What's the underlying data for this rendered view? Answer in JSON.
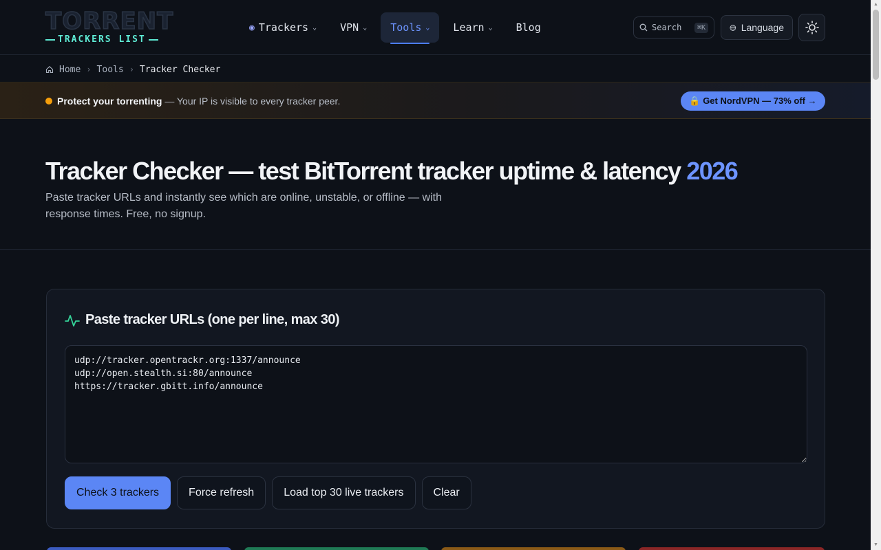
{
  "logo": {
    "top": "TORRENT",
    "bottom": "TRACKERS LIST"
  },
  "nav": [
    {
      "label": "Trackers",
      "has_menu": true,
      "active": false,
      "icon": "radio-icon"
    },
    {
      "label": "VPN",
      "has_menu": true,
      "active": false
    },
    {
      "label": "Tools",
      "has_menu": true,
      "active": true
    },
    {
      "label": "Learn",
      "has_menu": true,
      "active": false
    },
    {
      "label": "Blog",
      "has_menu": false,
      "active": false
    }
  ],
  "search": {
    "label": "Search",
    "shortcut": "⌘K"
  },
  "language": {
    "label": "Language"
  },
  "breadcrumb": {
    "home": "Home",
    "tools": "Tools",
    "current": "Tracker Checker"
  },
  "banner": {
    "bold": "Protect your torrenting",
    "text": " — Your IP is visible to every tracker peer.",
    "cta": "🔒 Get NordVPN — 73% off →"
  },
  "hero": {
    "title": "Tracker Checker — test BitTorrent tracker uptime & latency ",
    "year": "2026",
    "subtitle": "Paste tracker URLs and instantly see which are online, unstable, or offline — with response times. Free, no signup."
  },
  "checker": {
    "title": "Paste tracker URLs (one per line, max 30)",
    "textarea_value": "udp://tracker.opentrackr.org:1337/announce\nudp://open.stealth.si:80/announce\nhttps://tracker.gbitt.info/announce",
    "buttons": {
      "check": "Check 3 trackers",
      "refresh": "Force refresh",
      "load": "Load top 30 live trackers",
      "clear": "Clear"
    }
  },
  "colors": {
    "accent": "#5b86f5",
    "accent_text": "#6d94ff",
    "warning": "#f59e0b",
    "activity": "#34d399",
    "background": "#0d1118"
  }
}
